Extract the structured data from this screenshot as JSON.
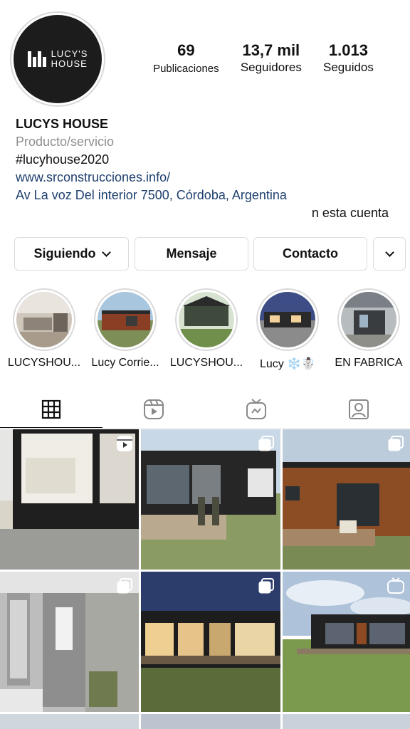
{
  "profile": {
    "avatar_logo_text_line1": "LUCY'S",
    "avatar_logo_text_line2": "HOUSE",
    "name": "LUCYS HOUSE",
    "category": "Producto/servicio",
    "hashtag": "#lucyhouse2020",
    "website": "www.srconstrucciones.info/",
    "address": "Av La voz Del interior 7500, Córdoba, Argentina",
    "extra_line": "n esta cuenta"
  },
  "stats": {
    "posts": {
      "value": "69",
      "label": "Publicaciones"
    },
    "followers": {
      "value": "13,7 mil",
      "label": "Seguidores"
    },
    "following": {
      "value": "1.013",
      "label": "Seguidos"
    }
  },
  "actions": {
    "following_label": "Siguiendo",
    "message_label": "Mensaje",
    "contact_label": "Contacto"
  },
  "highlights": [
    {
      "label": "LUCYSHOU..."
    },
    {
      "label": "Lucy Corrie..."
    },
    {
      "label": "LUCYSHOU..."
    },
    {
      "label": "Lucy ❄️☃️"
    },
    {
      "label": "EN FABRICA"
    }
  ],
  "tabs": [
    {
      "icon": "grid-icon",
      "active": true
    },
    {
      "icon": "reels-icon",
      "active": false
    },
    {
      "icon": "igtv-icon",
      "active": false
    },
    {
      "icon": "tagged-icon",
      "active": false
    }
  ],
  "posts": [
    {
      "badge": "reel"
    },
    {
      "badge": "multiple"
    },
    {
      "badge": "multiple"
    },
    {
      "badge": "multiple"
    },
    {
      "badge": "multiple"
    },
    {
      "badge": "igtv"
    }
  ],
  "colors": {
    "link": "#1e3f6e",
    "secondary_text": "#8e8e8e",
    "border": "#dbdbdb"
  }
}
